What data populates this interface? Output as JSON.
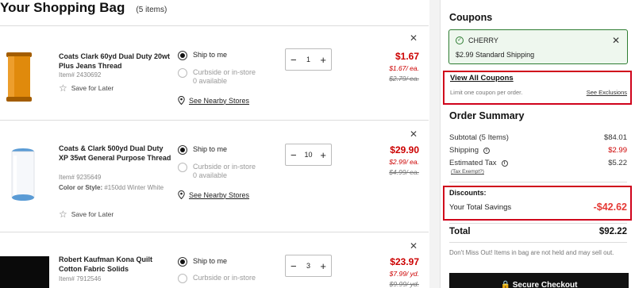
{
  "bag": {
    "title": "Your Shopping Bag",
    "count": "(5 items)"
  },
  "items": [
    {
      "name": "Coats Clark 60yd Dual Duty 20wt Plus Jeans Thread",
      "item_number": "Item# 2430692",
      "style_label": "",
      "style_value": "",
      "save_label": "Save for Later",
      "ship_label": "Ship to me",
      "curbside_label": "Curbside or in-store",
      "availability": "0 available",
      "stores_label": "See Nearby Stores",
      "qty": "1",
      "price": "$1.67",
      "price_each": "$1.67/ ea.",
      "price_was": "$2.79/ ea.",
      "thread_color": "#e08a0c"
    },
    {
      "name": "Coats & Clark 500yd Dual Duty XP 35wt General Purpose Thread",
      "item_number": "Item# 9235649",
      "style_label": "Color or Style:",
      "style_value": "#150dd Winter White",
      "save_label": "Save for Later",
      "ship_label": "Ship to me",
      "curbside_label": "Curbside or in-store",
      "availability": "0 available",
      "stores_label": "See Nearby Stores",
      "qty": "10",
      "price": "$29.90",
      "price_each": "$2.99/ ea.",
      "price_was": "$4.99/ ea.",
      "thread_color": "#f6f8fb"
    },
    {
      "name": "Robert Kaufman Kona Quilt Cotton Fabric Solids",
      "item_number": "Item# 7912546",
      "ship_label": "Ship to me",
      "curbside_label": "Curbside or in-store",
      "qty": "3",
      "price": "$23.97",
      "price_each": "$7.99/ yd.",
      "price_was": "$9.99/ yd."
    }
  ],
  "icons": {
    "remove": "close-icon",
    "star": "star-icon",
    "pin": "location-pin-icon",
    "plus": "plus-icon",
    "minus": "minus-icon"
  },
  "coupons": {
    "heading": "Coupons",
    "applied_code": "CHERRY",
    "applied_desc": "$2.99 Standard Shipping",
    "view_all": "View All Coupons",
    "limit": "Limit one coupon per order.",
    "exclusions": "See Exclusions"
  },
  "summary": {
    "heading": "Order Summary",
    "subtotal_label": "Subtotal (5 Items)",
    "subtotal_value": "$84.01",
    "shipping_label": "Shipping",
    "shipping_value": "$2.99",
    "tax_label": "Estimated Tax",
    "tax_value": "$5.22",
    "tax_exempt": "(Tax Exempt?)",
    "discounts_label": "Discounts:",
    "savings_label": "Your Total Savings",
    "savings_value": "-$42.62",
    "total_label": "Total",
    "total_value": "$92.22",
    "notice": "Don't Miss Out! Items in bag are not held and may sell out.",
    "checkout_label": "Secure Checkout"
  },
  "colors": {
    "sale_red": "#cc0000",
    "highlight_red": "#d0021b",
    "coupon_green": "#2e7d32"
  }
}
